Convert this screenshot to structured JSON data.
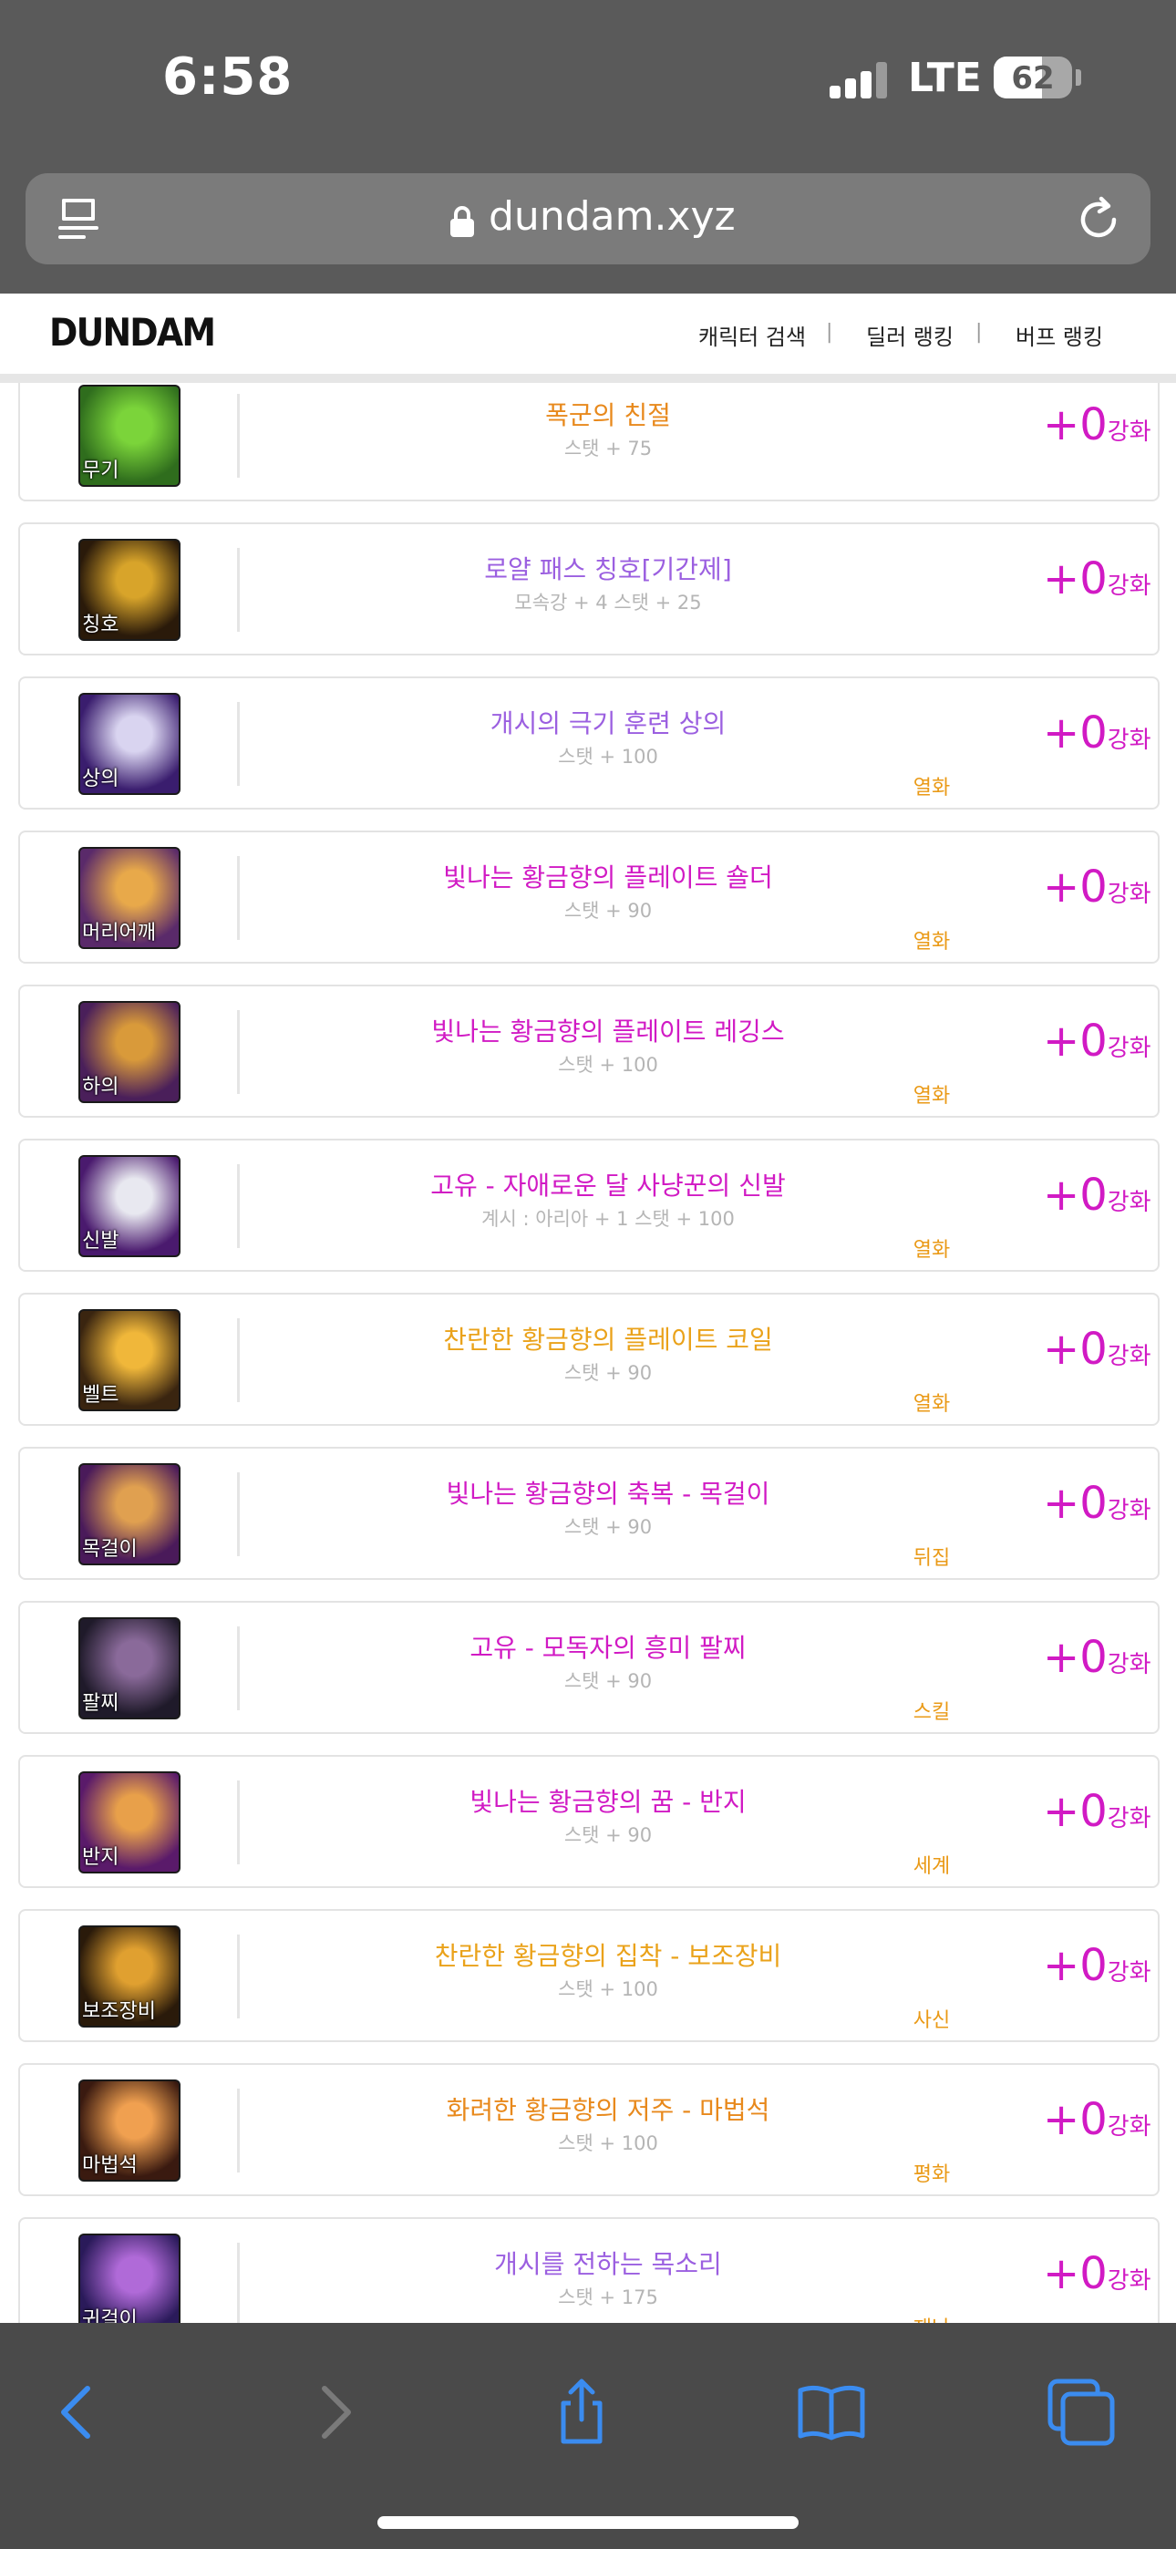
{
  "status_bar": {
    "time": "6:58",
    "network": "LTE",
    "battery": "62",
    "battery_level": 0.62
  },
  "browser": {
    "url": "dundam.xyz"
  },
  "site": {
    "logo": "DUNDAM",
    "nav": [
      "캐릭터 검색",
      "딜러 랭킹",
      "버프 랭킹"
    ]
  },
  "items": [
    {
      "slot": "무기",
      "name": "폭군의 친절",
      "stat": "스탯 + 75",
      "enchant": "",
      "reinforce": "+0",
      "reinforce_suffix": "강화",
      "name_color": "#e8891c",
      "icon_colors": [
        "#2f6d1d",
        "#7bd43a"
      ]
    },
    {
      "slot": "칭호",
      "name": "로얄 패스 칭호[기간제]",
      "stat": "모속강 + 4 스탯 + 25",
      "enchant": "",
      "reinforce": "+0",
      "reinforce_suffix": "강화",
      "name_color": "#9b5fe0",
      "icon_colors": [
        "#2a1a0a",
        "#d8a42a"
      ]
    },
    {
      "slot": "상의",
      "name": "개시의 극기 훈련 상의",
      "stat": "스탯 + 100",
      "enchant": "열화",
      "reinforce": "+0",
      "reinforce_suffix": "강화",
      "name_color": "#9b5fe0",
      "icon_colors": [
        "#3a1d6e",
        "#d9d4f0"
      ]
    },
    {
      "slot": "머리어깨",
      "name": "빛나는 황금향의 플레이트 숄더",
      "stat": "스탯 + 90",
      "enchant": "열화",
      "reinforce": "+0",
      "reinforce_suffix": "강화",
      "name_color": "#d11ac4",
      "icon_colors": [
        "#5a2a6a",
        "#e8a94a"
      ]
    },
    {
      "slot": "하의",
      "name": "빛나는 황금향의 플레이트 레깅스",
      "stat": "스탯 + 100",
      "enchant": "열화",
      "reinforce": "+0",
      "reinforce_suffix": "강화",
      "name_color": "#d11ac4",
      "icon_colors": [
        "#4a1f5a",
        "#d99a3a"
      ]
    },
    {
      "slot": "신발",
      "name": "고유 - 자애로운 달 사냥꾼의 신발",
      "stat": "계시 : 아리아 + 1 스탯 + 100",
      "enchant": "열화",
      "reinforce": "+0",
      "reinforce_suffix": "강화",
      "name_color": "#d11ac4",
      "icon_colors": [
        "#4a1a6e",
        "#e8e8f0"
      ]
    },
    {
      "slot": "벨트",
      "name": "찬란한 황금향의 플레이트 코일",
      "stat": "스탯 + 90",
      "enchant": "열화",
      "reinforce": "+0",
      "reinforce_suffix": "강화",
      "name_color": "#eaa21a",
      "icon_colors": [
        "#3a2510",
        "#f0b73a"
      ]
    },
    {
      "slot": "목걸이",
      "name": "빛나는 황금향의 축복 - 목걸이",
      "stat": "스탯 + 90",
      "enchant": "뒤집",
      "reinforce": "+0",
      "reinforce_suffix": "강화",
      "name_color": "#d11ac4",
      "icon_colors": [
        "#4a1a5a",
        "#e0a050"
      ]
    },
    {
      "slot": "팔찌",
      "name": "고유 - 모독자의 흥미 팔찌",
      "stat": "스탯 + 90",
      "enchant": "스킬",
      "reinforce": "+0",
      "reinforce_suffix": "강화",
      "name_color": "#d11ac4",
      "icon_colors": [
        "#1f1a2a",
        "#8a6a9a"
      ]
    },
    {
      "slot": "반지",
      "name": "빛나는 황금향의 꿈 - 반지",
      "stat": "스탯 + 90",
      "enchant": "세계",
      "reinforce": "+0",
      "reinforce_suffix": "강화",
      "name_color": "#d11ac4",
      "icon_colors": [
        "#5a1a6a",
        "#e8a04a"
      ]
    },
    {
      "slot": "보조장비",
      "name": "찬란한 황금향의 집착 - 보조장비",
      "stat": "스탯 + 100",
      "enchant": "사신",
      "reinforce": "+0",
      "reinforce_suffix": "강화",
      "name_color": "#eaa21a",
      "icon_colors": [
        "#2a1a0a",
        "#e0a030"
      ]
    },
    {
      "slot": "마법석",
      "name": "화려한 황금향의 저주 - 마법석",
      "stat": "스탯 + 100",
      "enchant": "평화",
      "reinforce": "+0",
      "reinforce_suffix": "강화",
      "name_color": "#e8891c",
      "icon_colors": [
        "#3a1a10",
        "#f0a050"
      ]
    },
    {
      "slot": "귀걸이",
      "name": "개시를 전하는 목소리",
      "stat": "스탯 + 175",
      "enchant": "재난",
      "reinforce": "+0",
      "reinforce_suffix": "강화",
      "name_color": "#9b5fe0",
      "icon_colors": [
        "#2a1a5a",
        "#b06ad8"
      ]
    }
  ],
  "colors": {
    "reinforce": "#d11ac4",
    "enchant": "#ea9a17",
    "chrome_top": "#5a5a5a",
    "chrome_bottom": "#4a4a4a",
    "toolbar_icon": "#3b8cf0"
  },
  "toolbar": {
    "icons": [
      "back-icon",
      "forward-icon",
      "share-icon",
      "bookmarks-icon",
      "tabs-icon"
    ]
  }
}
